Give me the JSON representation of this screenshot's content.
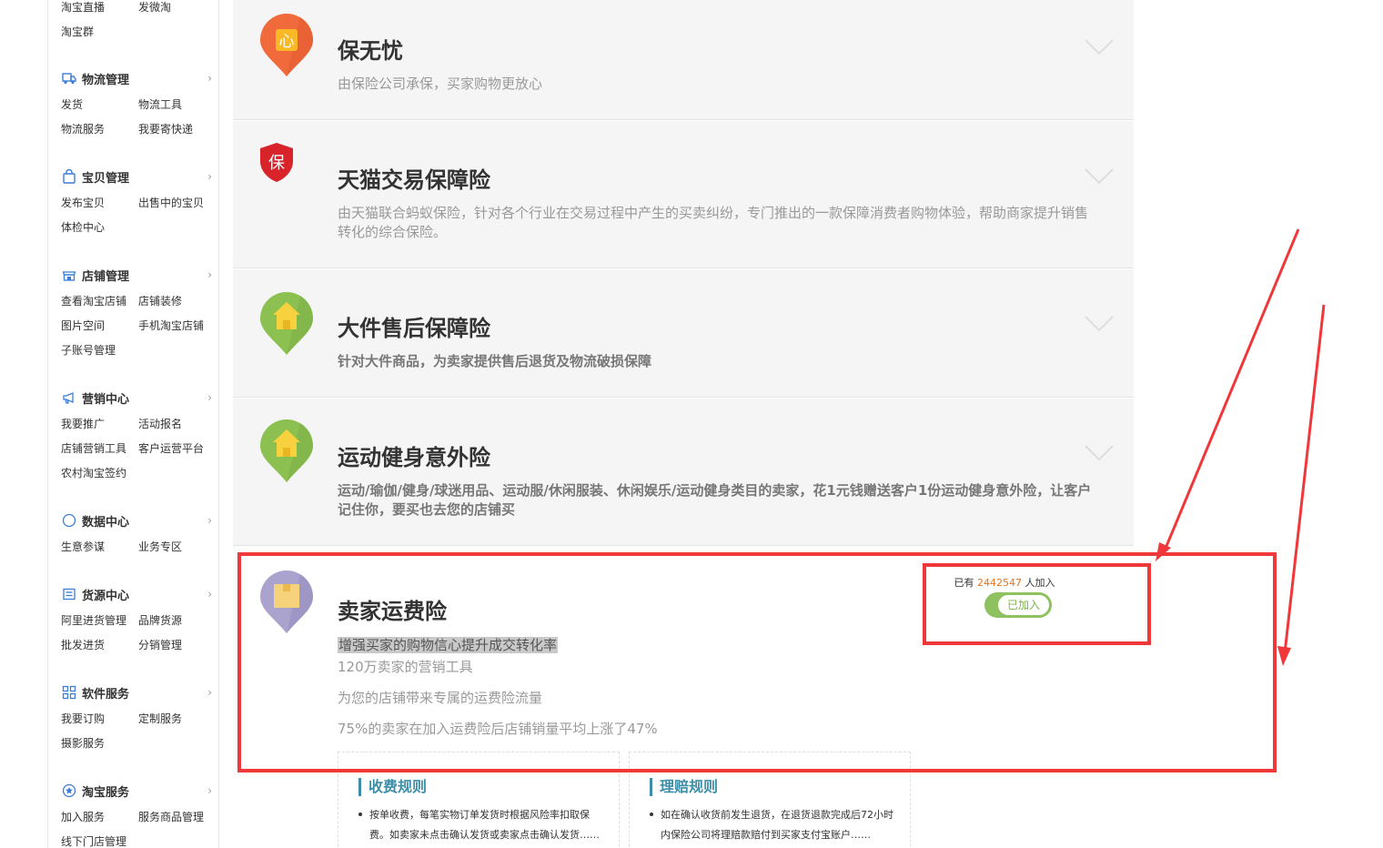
{
  "sidebar": {
    "top_links": [
      "淘宝直播",
      "发微淘",
      "淘宝群"
    ],
    "groups": [
      {
        "title": "物流管理",
        "icon": "truck-icon",
        "items": [
          "发货",
          "物流工具",
          "物流服务",
          "我要寄快递"
        ]
      },
      {
        "title": "宝贝管理",
        "icon": "bag-icon",
        "items": [
          "发布宝贝",
          "出售中的宝贝",
          "体检中心"
        ]
      },
      {
        "title": "店铺管理",
        "icon": "store-icon",
        "items": [
          "查看淘宝店铺",
          "店铺装修",
          "图片空间",
          "手机淘宝店铺",
          "子账号管理"
        ]
      },
      {
        "title": "营销中心",
        "icon": "megaphone-icon",
        "items": [
          "我要推广",
          "活动报名",
          "店铺营销工具",
          "客户运营平台",
          "农村淘宝签约"
        ]
      },
      {
        "title": "数据中心",
        "icon": "compass-icon",
        "items": [
          "生意参谋",
          "业务专区"
        ]
      },
      {
        "title": "货源中心",
        "icon": "supply-icon",
        "items": [
          "阿里进货管理",
          "品牌货源",
          "批发进货",
          "分销管理"
        ]
      },
      {
        "title": "软件服务",
        "icon": "apps-icon",
        "items": [
          "我要订购",
          "定制服务",
          "摄影服务"
        ]
      },
      {
        "title": "淘宝服务",
        "icon": "service-icon",
        "items": [
          "加入服务",
          "服务商品管理",
          "线下门店管理"
        ]
      }
    ]
  },
  "insurances": [
    {
      "title": "保无忧",
      "desc": "由保险公司承保，买家购物更放心",
      "icon": "heart-badge-icon",
      "icon_char": "心",
      "color": "#f06a3c"
    },
    {
      "title": "天猫交易保障险",
      "desc": "由天猫联合蚂蚁保险，针对各个行业在交易过程中产生的买卖纠纷，专门推出的一款保障消费者购物体验，帮助商家提升销售转化的综合保险。",
      "icon": "shield-icon",
      "icon_char": "保",
      "color": "#d9232b"
    },
    {
      "title": "大件售后保障险",
      "desc": "针对大件商品，为卖家提供售后退货及物流破损保障",
      "icon": "house-icon",
      "color": "#8cc152"
    },
    {
      "title": "运动健身意外险",
      "desc": "运动/瑜伽/健身/球迷用品、运动服/休闲服装、休闲娱乐/运动健身类目的卖家，花1元钱赠送客户1份运动健身意外险，让客户记住你，要买也去您的店铺买",
      "icon": "house-icon",
      "color": "#8cc152"
    }
  ],
  "freight": {
    "title": "卖家运费险",
    "icon": "box-icon",
    "highlight": "增强买家的购物信心提升成交转化率",
    "lines": [
      "120万卖家的营销工具",
      "为您的店铺带来专属的运费险流量",
      "75%的卖家在加入运费险后店铺销量平均上涨了47%"
    ],
    "joined_prefix": "已有",
    "joined_count": "2442547",
    "joined_suffix": "人加入",
    "joined_button": "已加入",
    "rules": [
      {
        "title": "收费规则",
        "text": "按单收费，每笔实物订单发货时根据风险率扣取保费。如卖家未点击确认发货或卖家点击确认发货……"
      },
      {
        "title": "理赔规则",
        "text": "如在确认收货前发生退货，在退货退款完成后72小时内保险公司将理赔款赔付到买家支付宝账户……"
      }
    ]
  },
  "colors": {
    "annotation": "#f0383b",
    "accent_green": "#8ec15f",
    "count_orange": "#e8731d",
    "rule_blue": "#3d8ea8"
  }
}
